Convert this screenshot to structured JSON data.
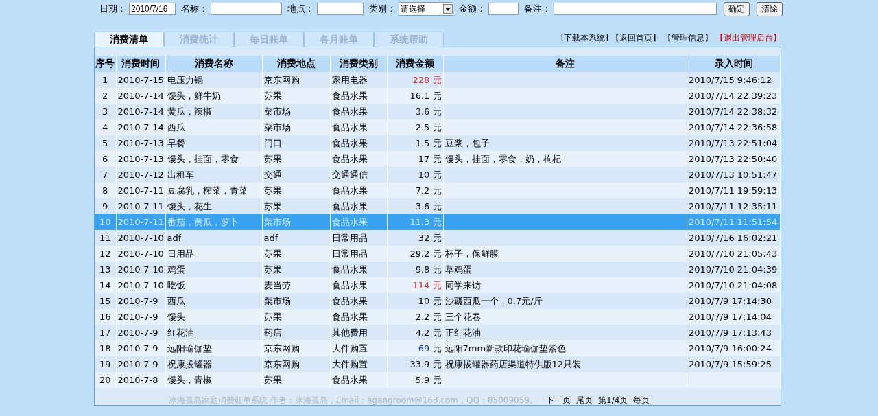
{
  "filter_form": {
    "fields": [
      {
        "kind": "input",
        "label": "日期：",
        "value": "2010/7/16"
      },
      {
        "kind": "input",
        "label": "名称："
      },
      {
        "kind": "input",
        "label": "地点："
      },
      {
        "kind": "select",
        "label": "类别：",
        "value": "请选择"
      },
      {
        "kind": "input",
        "label": "金额："
      },
      {
        "kind": "input",
        "label": "备注："
      }
    ],
    "buttons": [
      "确定",
      "清除"
    ]
  },
  "tabs": [
    {
      "label": "消费清单",
      "selected": true
    },
    {
      "label": "消费统计",
      "selected": false
    },
    {
      "label": "每日账单",
      "selected": false
    },
    {
      "label": "各月账单",
      "selected": false
    },
    {
      "label": "系统帮助",
      "selected": false
    }
  ],
  "top_links": [
    {
      "label": "[下载本系统]",
      "color": "#000000"
    },
    {
      "label": "【返回首页】",
      "color": "#000000"
    },
    {
      "label": "【管理信息】",
      "color": "#000000"
    },
    {
      "label": "【退出管理后台】",
      "color": "#cc0000"
    }
  ],
  "table": {
    "columns": [
      "序号",
      "消费时间",
      "消费名称",
      "消费地点",
      "消费类别",
      "消费金额",
      "备注",
      "录入时间"
    ],
    "rows": [
      {
        "no": "1",
        "date": "2010-7-15",
        "name": "电压力锅",
        "place": "京东网购",
        "category": "家用电器",
        "amount": "228",
        "unit": "元",
        "color": "#e03030",
        "selected": false,
        "recorded": "2010/7/15 9:46:12"
      },
      {
        "no": "2",
        "date": "2010-7-14",
        "name": "馒头，鲜牛奶",
        "place": "苏果",
        "category": "食品水果",
        "amount": "16.1",
        "unit": "元",
        "color": "#000000",
        "selected": false,
        "recorded": "2010/7/14 22:39:23"
      },
      {
        "no": "3",
        "date": "2010-7-14",
        "name": "黄瓜，辣椒",
        "place": "菜市场",
        "category": "食品水果",
        "amount": "3.6",
        "unit": "元",
        "color": "#000000",
        "selected": false,
        "recorded": "2010/7/14 22:38:32"
      },
      {
        "no": "4",
        "date": "2010-7-14",
        "name": "西瓜",
        "place": "菜市场",
        "category": "食品水果",
        "amount": "2.5",
        "unit": "元",
        "color": "#000000",
        "selected": false,
        "recorded": "2010/7/14 22:36:58"
      },
      {
        "no": "5",
        "date": "2010-7-13",
        "name": "早餐",
        "place": "门口",
        "category": "食品水果",
        "amount": "1.5",
        "unit": "元",
        "color": "#000000",
        "selected": false,
        "note": "豆浆，包子",
        "recorded": "2010/7/13 22:51:04"
      },
      {
        "no": "6",
        "date": "2010-7-13",
        "name": "馒头，挂面，零食",
        "place": "苏果",
        "category": "食品水果",
        "amount": "17",
        "unit": "元",
        "color": "#000000",
        "selected": false,
        "note": "馒头，挂面，零食，奶，枸杞",
        "recorded": "2010/7/13 22:50:40"
      },
      {
        "no": "7",
        "date": "2010-7-12",
        "name": "出租车",
        "place": "交通",
        "category": "交通通信",
        "amount": "10",
        "unit": "元",
        "color": "#000000",
        "selected": false,
        "recorded": "2010/7/13 10:51:47"
      },
      {
        "no": "8",
        "date": "2010-7-11",
        "name": "豆腐乳，榨菜，青菜",
        "place": "苏果",
        "category": "食品水果",
        "amount": "7.2",
        "unit": "元",
        "color": "#000000",
        "selected": false,
        "recorded": "2010/7/11 19:59:13"
      },
      {
        "no": "9",
        "date": "2010-7-11",
        "name": "馒头，花生",
        "place": "苏果",
        "category": "食品水果",
        "amount": "3.6",
        "unit": "元",
        "color": "#000000",
        "selected": false,
        "recorded": "2010/7/11 12:35:11"
      },
      {
        "no": "10",
        "date": "2010-7-11",
        "name": "番茄，黄瓜，萝卜",
        "place": "菜市场",
        "category": "食品水果",
        "amount": "11.3",
        "unit": "元",
        "color": "#cfe8ff",
        "selected": true,
        "recorded": "2010/7/11 11:51:54"
      },
      {
        "no": "11",
        "date": "2010-7-10",
        "name": "adf",
        "place": "adf",
        "category": "日常用品",
        "amount": "32",
        "unit": "元",
        "color": "#000000",
        "selected": false,
        "recorded": "2010/7/16 16:02:21"
      },
      {
        "no": "12",
        "date": "2010-7-10",
        "name": "日用品",
        "place": "苏果",
        "category": "日常用品",
        "amount": "29.2",
        "unit": "元",
        "color": "#000000",
        "selected": false,
        "note": "杯子，保鲜膜",
        "recorded": "2010/7/10 21:05:43"
      },
      {
        "no": "13",
        "date": "2010-7-10",
        "name": "鸡蛋",
        "place": "苏果",
        "category": "食品水果",
        "amount": "9.8",
        "unit": "元",
        "color": "#000000",
        "selected": false,
        "note": "草鸡蛋",
        "recorded": "2010/7/10 21:04:39"
      },
      {
        "no": "14",
        "date": "2010-7-10",
        "name": "吃饭",
        "place": "麦当劳",
        "category": "食品水果",
        "amount": "114",
        "unit": "元",
        "color": "#e03030",
        "selected": false,
        "note": "同学来访",
        "recorded": "2010/7/10 21:04:08"
      },
      {
        "no": "15",
        "date": "2010-7-9",
        "name": "西瓜",
        "place": "菜市场",
        "category": "食品水果",
        "amount": "10",
        "unit": "元",
        "color": "#000000",
        "selected": false,
        "note": "沙瓤西瓜一个，0.7元/斤",
        "recorded": "2010/7/9 17:14:30"
      },
      {
        "no": "16",
        "date": "2010-7-9",
        "name": "馒头",
        "place": "苏果",
        "category": "食品水果",
        "amount": "2.2",
        "unit": "元",
        "color": "#000000",
        "selected": false,
        "note": "三个花卷",
        "recorded": "2010/7/9 17:14:04"
      },
      {
        "no": "17",
        "date": "2010-7-9",
        "name": "红花油",
        "place": "药店",
        "category": "其他费用",
        "amount": "4.2",
        "unit": "元",
        "color": "#000000",
        "selected": false,
        "note": "正红花油",
        "recorded": "2010/7/9 17:13:43"
      },
      {
        "no": "18",
        "date": "2010-7-9",
        "name": "远阳瑜伽垫",
        "place": "京东网购",
        "category": "大件购置",
        "amount": "69",
        "unit": "元",
        "color": "#1030a0",
        "selected": false,
        "note": "远阳7mm新款印花瑜伽垫紫色",
        "recorded": "2010/7/9 16:00:24"
      },
      {
        "no": "19",
        "date": "2010-7-9",
        "name": "祝康拔罐器",
        "place": "京东网购",
        "category": "大件购置",
        "amount": "33.9",
        "unit": "元",
        "color": "#000000",
        "selected": false,
        "note": "祝康拔罐器药店渠道特供版12只装",
        "recorded": "2010/7/9 15:59:25"
      },
      {
        "no": "20",
        "date": "2010-7-8",
        "name": "馒头，青椒",
        "place": "苏果",
        "category": "食品水果",
        "amount": "5.9",
        "unit": "元",
        "color": "#000000",
        "selected": false
      }
    ]
  },
  "footer": {
    "credits": "冰海孤岛家庭消费账单系统 作者：冰海孤岛，Email：agangroom@163.com，QQ：85009059。",
    "pager": [
      "下一页",
      "尾页",
      "第1/4页",
      "每页"
    ]
  }
}
